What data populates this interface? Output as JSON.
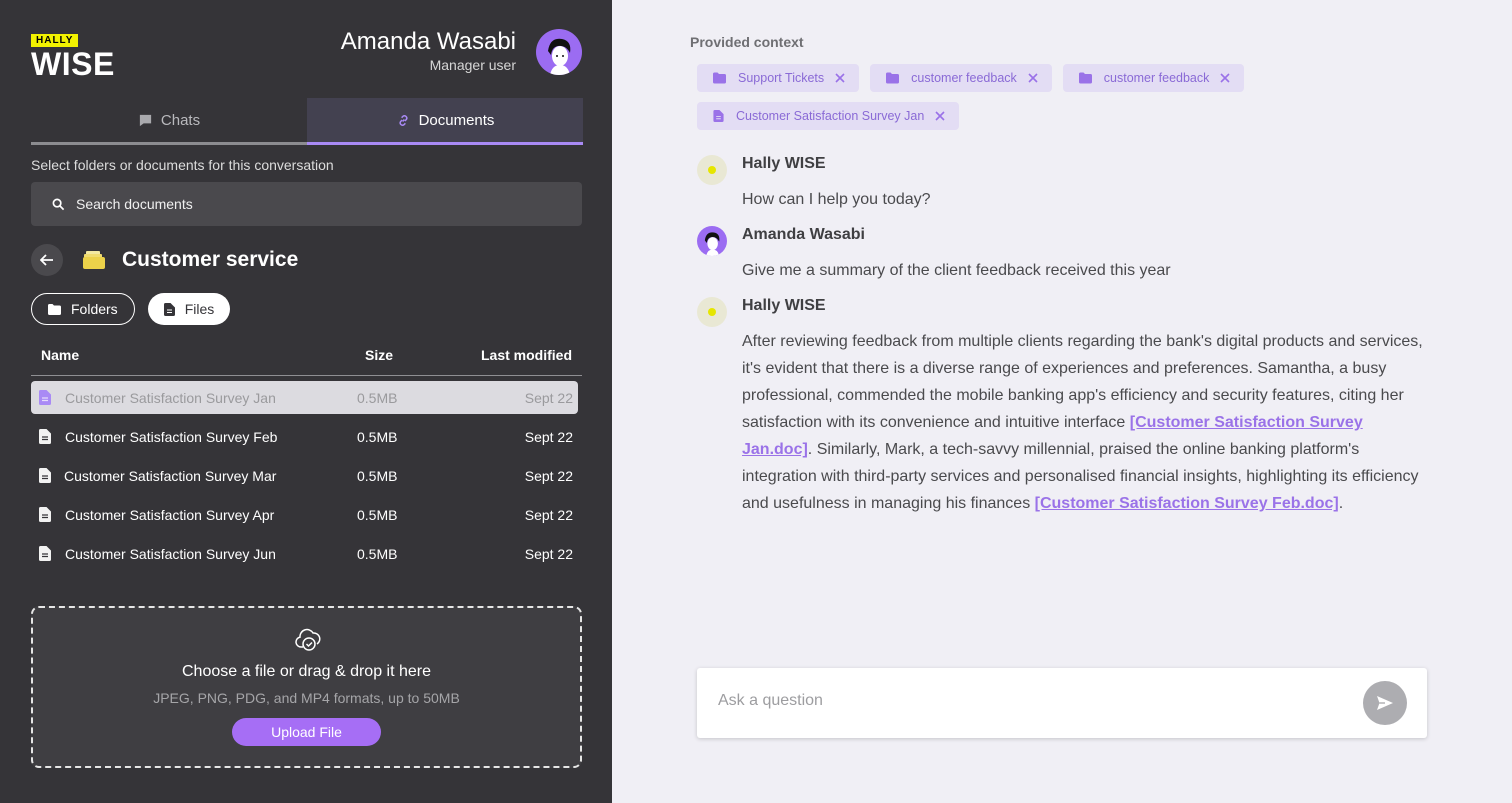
{
  "app": {
    "logo_badge": "HALLY",
    "logo_text": "WISE"
  },
  "user": {
    "name": "Amanda Wasabi",
    "role": "Manager user"
  },
  "tabs": [
    {
      "label": "Chats",
      "icon": "chat-icon",
      "active": false
    },
    {
      "label": "Documents",
      "icon": "link-icon",
      "active": true
    }
  ],
  "documents": {
    "hint": "Select folders or documents for this conversation",
    "search_placeholder": "Search documents",
    "folder_title": "Customer service",
    "filters": [
      {
        "label": "Folders",
        "icon": "folder-icon",
        "selected": false
      },
      {
        "label": "Files",
        "icon": "file-icon",
        "selected": true
      }
    ],
    "columns": {
      "name": "Name",
      "size": "Size",
      "modified": "Last modified"
    },
    "files": [
      {
        "name": "Customer Satisfaction Survey Jan",
        "size": "0.5MB",
        "modified": "Sept 22",
        "selected": true
      },
      {
        "name": "Customer Satisfaction Survey Feb",
        "size": "0.5MB",
        "modified": "Sept 22",
        "selected": false
      },
      {
        "name": "Customer Satisfaction Survey Mar",
        "size": "0.5MB",
        "modified": "Sept 22",
        "selected": false
      },
      {
        "name": "Customer Satisfaction Survey Apr",
        "size": "0.5MB",
        "modified": "Sept 22",
        "selected": false
      },
      {
        "name": "Customer Satisfaction Survey Jun",
        "size": "0.5MB",
        "modified": "Sept 22",
        "selected": false
      }
    ],
    "upload": {
      "title": "Choose a file or drag & drop it here",
      "subtitle": "JPEG, PNG, PDG, and MP4 formats, up to 50MB",
      "button": "Upload File"
    }
  },
  "context": {
    "label": "Provided context",
    "chips": [
      {
        "label": "Support Tickets",
        "type": "folder"
      },
      {
        "label": "customer feedback",
        "type": "folder"
      },
      {
        "label": "customer feedback",
        "type": "folder"
      },
      {
        "label": "Customer Satisfaction Survey Jan",
        "type": "file"
      }
    ]
  },
  "messages": [
    {
      "author": "Hally WISE",
      "role": "bot",
      "text": "How can I help you today?"
    },
    {
      "author": "Amanda Wasabi",
      "role": "human",
      "text": "Give me a summary of the client feedback received this year"
    },
    {
      "author": "Hally WISE",
      "role": "bot",
      "parts": [
        "After reviewing feedback from multiple clients regarding the bank's digital products and services, it's evident that there is a diverse range of experiences and preferences. Samantha, a busy professional, commended the mobile banking app's efficiency and security features, citing her satisfaction with its convenience and intuitive interface ",
        "[Customer Satisfaction Survey Jan.doc]",
        ". Similarly, Mark, a tech-savvy millennial, praised the online banking platform's integration with third-party services and personalised financial insights, highlighting its efficiency and usefulness in managing his finances ",
        "[Customer Satisfaction Survey Feb.doc]",
        "."
      ]
    }
  ],
  "composer": {
    "placeholder": "Ask a question"
  },
  "colors": {
    "sidebar": "#353438",
    "accent": "#a66ef5",
    "logo_yellow": "#f2f200",
    "chip_bg": "#e3ddf4",
    "link": "#9a72e8"
  }
}
